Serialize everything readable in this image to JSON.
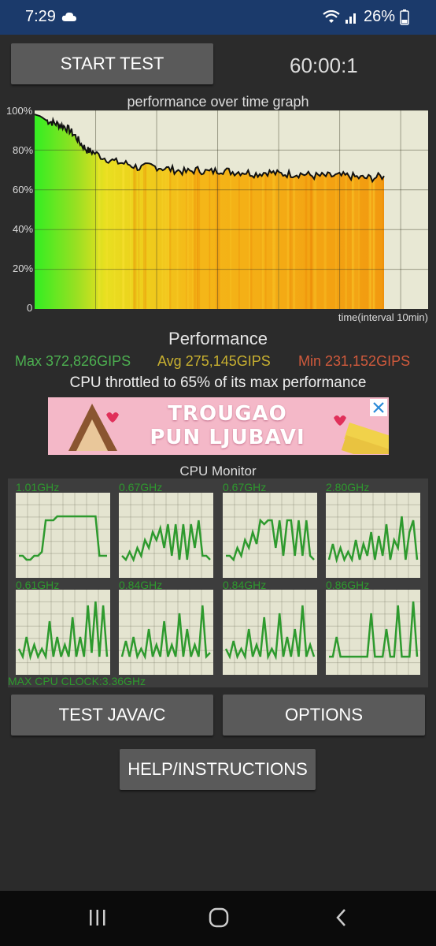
{
  "status_bar": {
    "time": "7:29",
    "battery": "26%",
    "icons": [
      "cloud-icon",
      "wifi-icon",
      "signal-icon",
      "battery-icon"
    ]
  },
  "controls": {
    "start_label": "START TEST",
    "timer": "60:00:1"
  },
  "graph": {
    "title": "performance over time graph",
    "x_label": "time(interval 10min)",
    "y_ticks": [
      "100%",
      "80%",
      "60%",
      "40%",
      "20%",
      "0"
    ]
  },
  "performance": {
    "title": "Performance",
    "max": "Max 372,826GIPS",
    "avg": "Avg 275,145GIPS",
    "min": "Min 231,152GIPS",
    "throttle": "CPU throttled to 65% of its max performance"
  },
  "ad": {
    "line1": "TROUGAO",
    "line2": "PUN LJUBAVI"
  },
  "cpu_monitor": {
    "title": "CPU Monitor",
    "cores": [
      "1.01GHz",
      "0.67GHz",
      "0.67GHz",
      "2.80GHz",
      "0.61GHz",
      "0.84GHz",
      "0.84GHz",
      "0.86GHz"
    ],
    "max_clock": "MAX CPU CLOCK:3.36GHz"
  },
  "buttons": {
    "test_java": "TEST JAVA/C",
    "options": "OPTIONS",
    "help": "HELP/INSTRUCTIONS"
  },
  "colors": {
    "status_bar": "#1b3a6b",
    "background": "#2b2b2b",
    "button": "#5a5a5a",
    "max": "#4caf50",
    "avg": "#c8b030",
    "min": "#d05a3c",
    "graph_line": "#2e9a2e"
  },
  "chart_data": {
    "type": "area",
    "title": "performance over time graph",
    "xlabel": "time(interval 10min)",
    "ylabel": "",
    "ylim": [
      0,
      100
    ],
    "y_ticks": [
      "0",
      "20%",
      "40%",
      "60%",
      "80%",
      "100%"
    ],
    "grid": true,
    "x_minutes": [
      0,
      1,
      2,
      3,
      4,
      5,
      6,
      7,
      8,
      9,
      10,
      12,
      14,
      16,
      18,
      20,
      22,
      24,
      26,
      28,
      30,
      32,
      34,
      36,
      38,
      40,
      42,
      44,
      46,
      48,
      50,
      52,
      54,
      56,
      58,
      60
    ],
    "values": [
      98,
      97,
      95,
      94,
      93,
      92,
      90,
      87,
      83,
      80,
      79,
      76,
      74,
      73,
      71,
      72,
      71,
      70,
      69,
      70,
      69,
      70,
      69,
      69,
      68,
      69,
      68,
      68,
      68,
      67,
      67,
      67,
      67,
      66,
      66,
      67
    ]
  }
}
